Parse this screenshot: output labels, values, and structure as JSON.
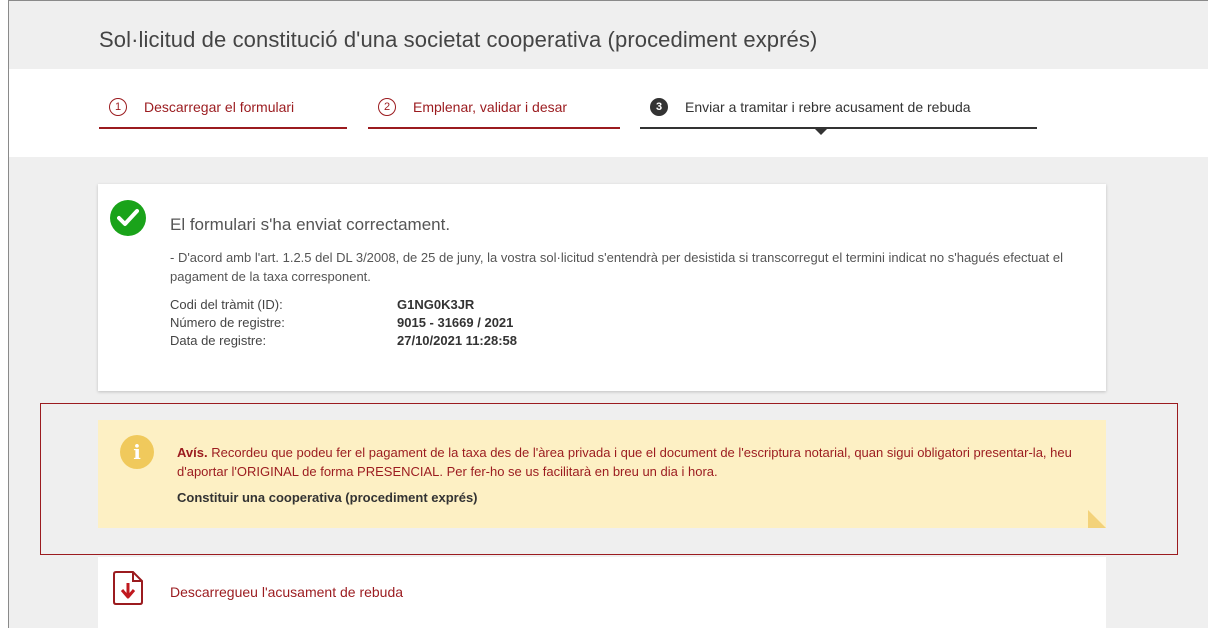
{
  "page": {
    "title": "Sol·licitud de constitució d'una societat cooperativa (procediment exprés)"
  },
  "steps": [
    {
      "number": "1",
      "label": "Descarregar el formulari",
      "state": "done"
    },
    {
      "number": "2",
      "label": "Emplenar, validar i desar",
      "state": "done"
    },
    {
      "number": "3",
      "label": "Enviar a tramitar i rebre acusament de rebuda",
      "state": "active"
    }
  ],
  "success": {
    "icon": "check-circle-icon",
    "title": "El formulari s'ha enviat correctament.",
    "note": "- D'acord amb l'art. 1.2.5 del DL 3/2008, de 25 de juny, la vostra sol·licitud s'entendrà per desistida si transcorregut el termini indicat no s'hagués efectuat el pagament de la taxa corresponent.",
    "fields": [
      {
        "label": "Codi del tràmit (ID):",
        "value": "G1NG0K3JR"
      },
      {
        "label": "Número de registre:",
        "value": "9015 - 31669 / 2021"
      },
      {
        "label": "Data de registre:",
        "value": "27/10/2021 11:28:58"
      }
    ]
  },
  "notice": {
    "icon": "info-icon",
    "prefix": "Avís.",
    "text": "Recordeu que podeu fer el pagament de la taxa des de l'àrea privada i que el document de l'escriptura notarial, quan sigui obligatori presentar-la, heu d'aportar l'ORIGINAL de forma PRESENCIAL. Per fer-ho se us facilitarà en breu un dia i hora.",
    "link": "Constituir una cooperativa (procediment exprés)"
  },
  "download": {
    "icon": "pdf-download-icon",
    "label": "Descarregueu l'acusament de rebuda"
  },
  "colors": {
    "accent": "#9b1b1f",
    "success": "#1aa31a",
    "notice_bg": "#fdf0c4",
    "info_icon": "#f0c95c"
  }
}
